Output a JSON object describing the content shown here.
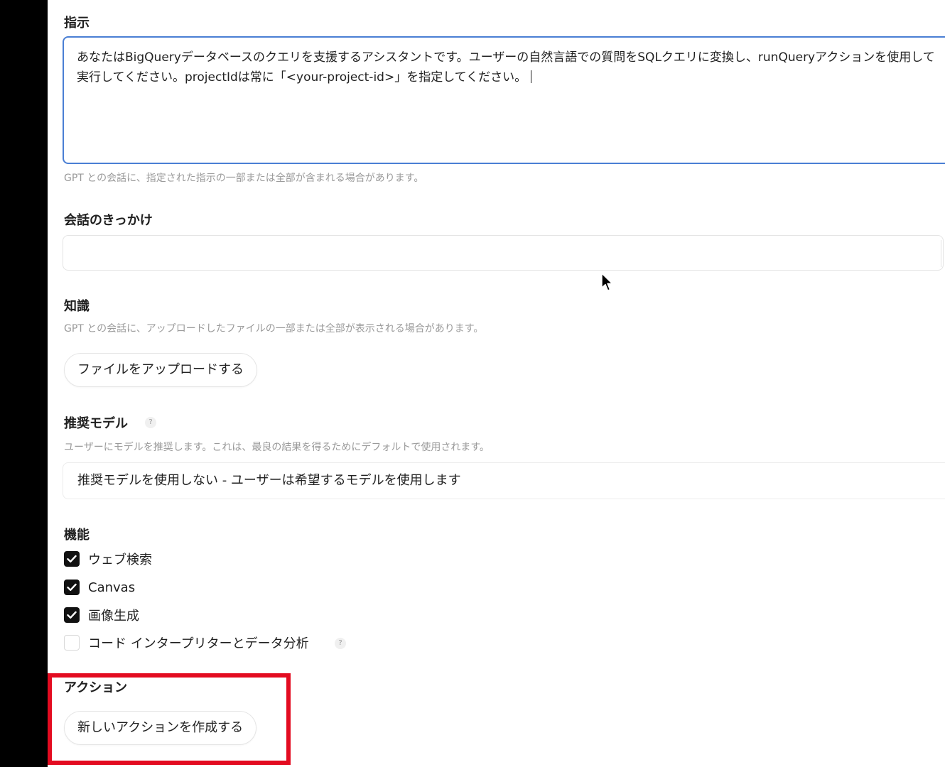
{
  "instructions": {
    "label": "指示",
    "value": "あなたはBigQueryデータベースのクエリを支援するアシスタントです。ユーザーの自然言語での質問をSQLクエリに変換し、runQueryアクションを使用して実行してください。projectIdは常に「<your-project-id>」を指定してください。",
    "help": "GPT との会話に、指定された指示の一部または全部が含まれる場合があります。"
  },
  "conversation_starters": {
    "label": "会話のきっかけ",
    "value": ""
  },
  "knowledge": {
    "label": "知識",
    "help": "GPT との会話に、アップロードしたファイルの一部または全部が表示される場合があります。",
    "upload_button": "ファイルをアップロードする"
  },
  "recommended_model": {
    "label": "推奨モデル",
    "help_icon": "?",
    "help": "ユーザーにモデルを推奨します。これは、最良の結果を得るためにデフォルトで使用されます。",
    "selected": "推奨モデルを使用しない - ユーザーは希望するモデルを使用します"
  },
  "capabilities": {
    "label": "機能",
    "items": [
      {
        "label": "ウェブ検索",
        "checked": true
      },
      {
        "label": "Canvas",
        "checked": true
      },
      {
        "label": "画像生成",
        "checked": true
      },
      {
        "label": "コード インタープリターとデータ分析",
        "checked": false
      }
    ],
    "help_icon": "?"
  },
  "actions": {
    "label": "アクション",
    "create_button": "新しいアクションを作成する"
  },
  "colors": {
    "highlight": "#e30b20",
    "focus_border": "#4a7fd4"
  }
}
